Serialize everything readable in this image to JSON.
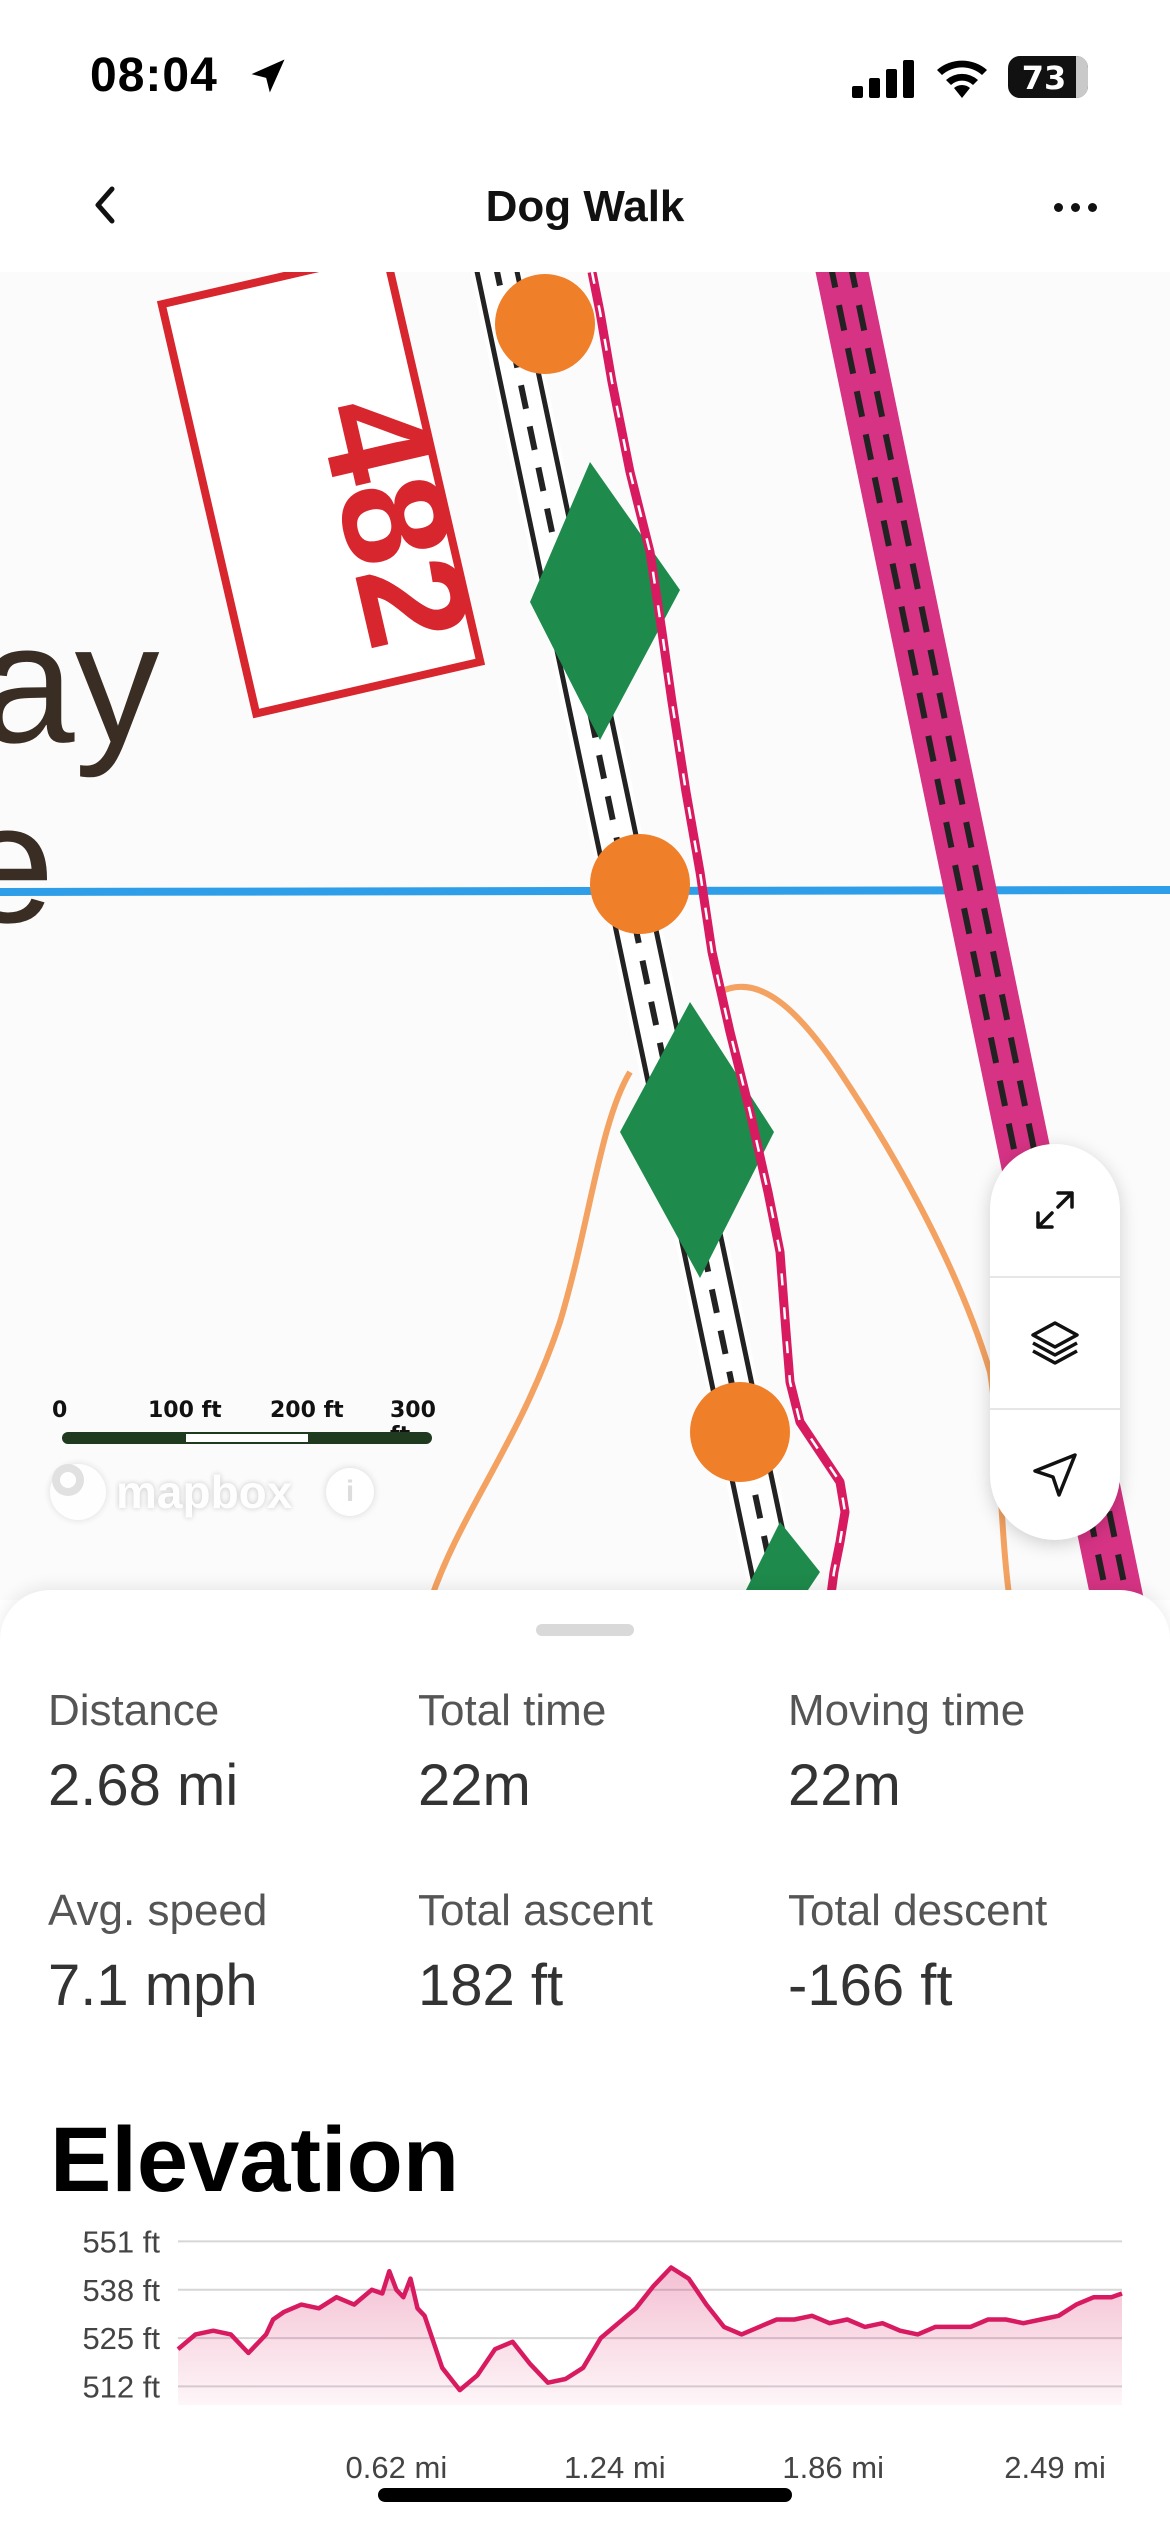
{
  "status_bar": {
    "time": "08:04",
    "battery": "73",
    "icons": [
      "location-arrow-icon",
      "signal-icon",
      "wifi-icon",
      "battery-icon"
    ]
  },
  "nav": {
    "title": "Dog Walk",
    "back_icon": "chevron-left-icon",
    "more_icon": "ellipsis-icon"
  },
  "map": {
    "labels": {
      "route_number": "482",
      "place_fragment_1": "ay",
      "place_fragment_2": "e"
    },
    "scale": {
      "labels": [
        "0",
        "100 ft",
        "200 ft",
        "300 ft"
      ]
    },
    "attribution": "mapbox",
    "info_icon": "info-icon",
    "controls": [
      {
        "name": "expand-icon"
      },
      {
        "name": "layers-icon"
      },
      {
        "name": "navigate-icon"
      }
    ],
    "colors": {
      "track": "#d81b60",
      "path": "#d63384",
      "water": "#2f9ee8",
      "marker": "#f07f2a",
      "feature": "#1e8a4b",
      "contour": "#f4a261",
      "route_box": "#d7262e"
    }
  },
  "stats": [
    {
      "label": "Distance",
      "value": "2.68 mi"
    },
    {
      "label": "Total time",
      "value": "22m"
    },
    {
      "label": "Moving time",
      "value": "22m"
    },
    {
      "label": "Avg. speed",
      "value": "7.1 mph"
    },
    {
      "label": "Total ascent",
      "value": "182 ft"
    },
    {
      "label": "Total descent",
      "value": "-166 ft"
    }
  ],
  "elevation": {
    "title": "Elevation"
  },
  "chart_data": {
    "type": "area",
    "title": "Elevation",
    "x_unit": "mi",
    "y_unit": "ft",
    "ylim": [
      507,
      553
    ],
    "xlim": [
      0,
      2.68
    ],
    "y_ticks": [
      "551 ft",
      "538 ft",
      "525 ft",
      "512 ft"
    ],
    "y_tick_values": [
      551,
      538,
      525,
      512
    ],
    "x_ticks": [
      "0.62 mi",
      "1.24 mi",
      "1.86 mi",
      "2.49 mi"
    ],
    "x_tick_values": [
      0.62,
      1.24,
      1.86,
      2.49
    ],
    "grid": true,
    "color": "#d81b60",
    "x": [
      0.0,
      0.05,
      0.1,
      0.15,
      0.2,
      0.25,
      0.27,
      0.3,
      0.35,
      0.4,
      0.45,
      0.5,
      0.55,
      0.58,
      0.6,
      0.62,
      0.64,
      0.66,
      0.68,
      0.7,
      0.75,
      0.8,
      0.85,
      0.9,
      0.95,
      1.0,
      1.05,
      1.1,
      1.15,
      1.2,
      1.25,
      1.3,
      1.35,
      1.4,
      1.45,
      1.5,
      1.55,
      1.6,
      1.65,
      1.7,
      1.75,
      1.8,
      1.85,
      1.9,
      1.95,
      2.0,
      2.05,
      2.1,
      2.15,
      2.2,
      2.25,
      2.3,
      2.35,
      2.4,
      2.45,
      2.5,
      2.55,
      2.6,
      2.65,
      2.68
    ],
    "y": [
      522,
      526,
      527,
      526,
      521,
      526,
      530,
      532,
      534,
      533,
      536,
      534,
      538,
      537,
      543,
      538,
      536,
      541,
      533,
      531,
      517,
      511,
      515,
      522,
      524,
      518,
      513,
      514,
      517,
      525,
      529,
      533,
      539,
      544,
      541,
      534,
      528,
      526,
      528,
      530,
      530,
      531,
      529,
      530,
      528,
      529,
      527,
      526,
      528,
      528,
      528,
      530,
      530,
      529,
      530,
      531,
      534,
      536,
      536,
      537
    ]
  }
}
